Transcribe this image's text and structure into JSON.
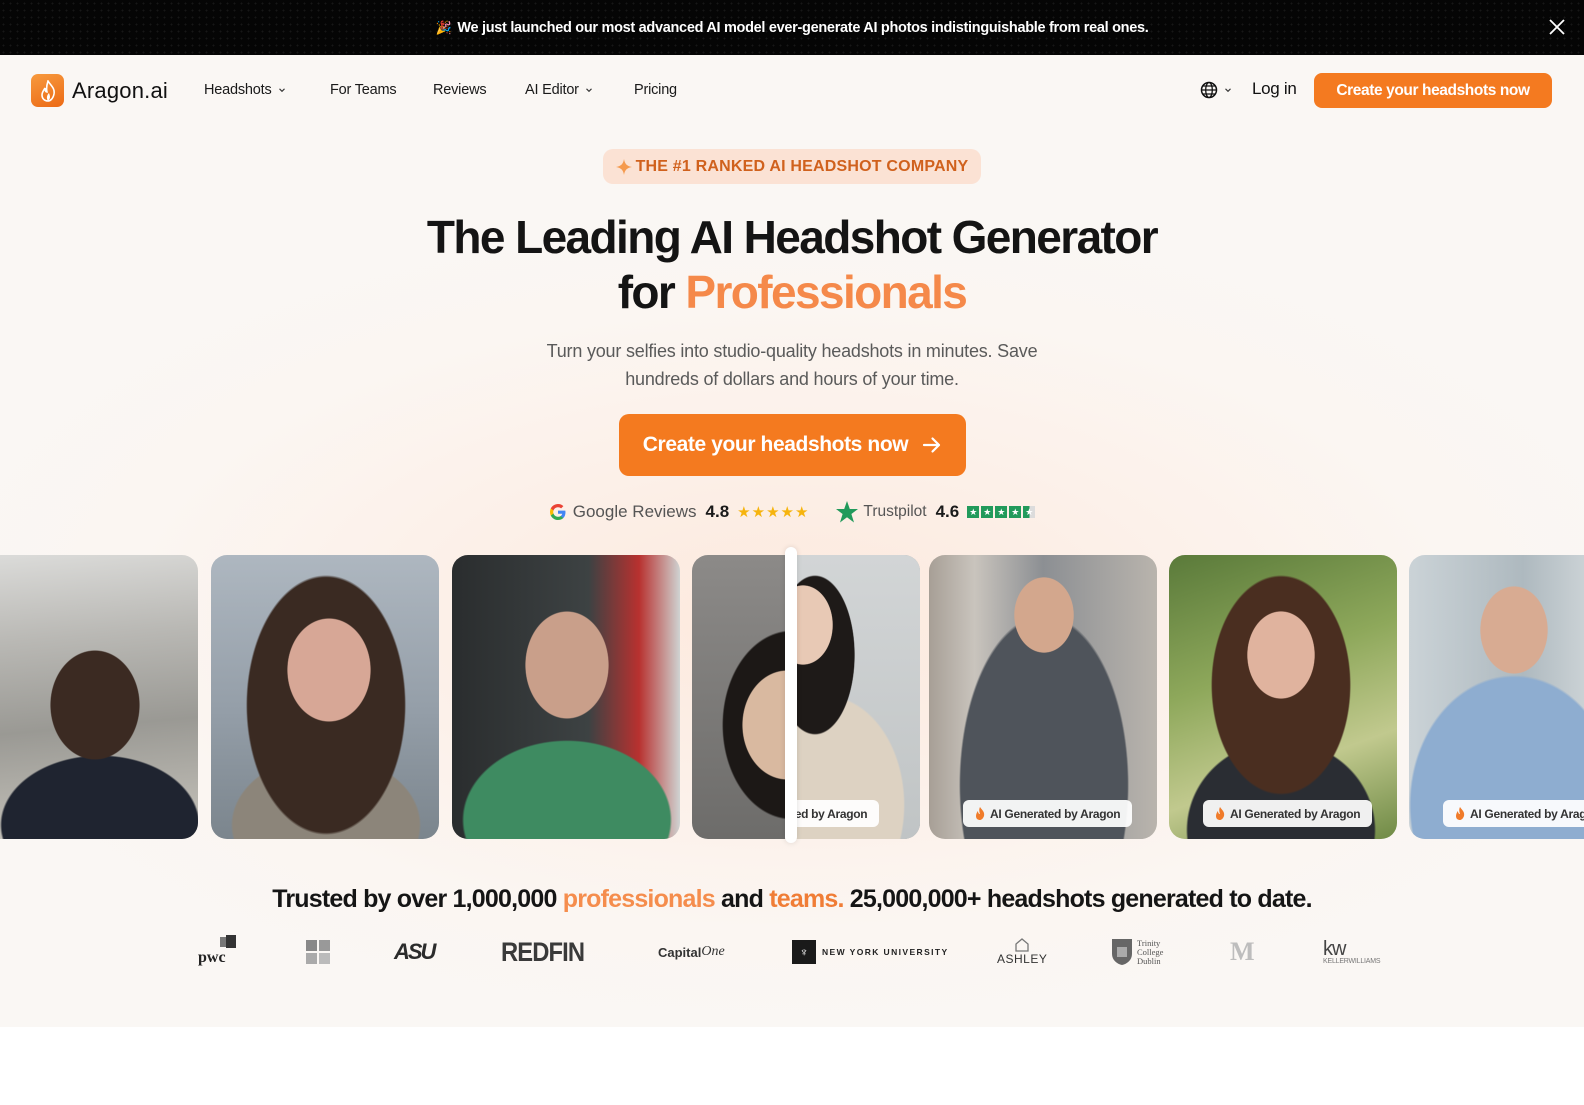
{
  "banner": {
    "icon": "party-popper-icon",
    "text": "We just launched our most advanced AI model ever-generate AI photos indistinguishable from real ones.",
    "close_icon": "close-icon"
  },
  "nav": {
    "logo_text": "Aragon.ai",
    "items": [
      {
        "label": "Headshots",
        "has_dropdown": true
      },
      {
        "label": "For Teams",
        "has_dropdown": false
      },
      {
        "label": "Reviews",
        "has_dropdown": false
      },
      {
        "label": "AI Editor",
        "has_dropdown": true
      },
      {
        "label": "Pricing",
        "has_dropdown": false
      }
    ],
    "language_icon": "globe-icon",
    "login_label": "Log in",
    "cta_label": "Create your headshots now"
  },
  "hero": {
    "badge": "THE #1 RANKED AI HEADSHOT COMPANY",
    "title_line1": "The Leading AI Headshot Generator",
    "title_line2_prefix": "for ",
    "title_line2_accent": "Professionals",
    "subtitle_line1": "Turn your selfies into studio-quality headshots in minutes. Save",
    "subtitle_line2": "hundreds of dollars and hours of your time.",
    "cta_label": "Create your headshots now",
    "cta_icon": "arrow-right-icon"
  },
  "ratings": {
    "google": {
      "label": "Google Reviews",
      "score": "4.8",
      "stars": 5
    },
    "trustpilot": {
      "label": "Trustpilot",
      "score": "4.6",
      "stars": 4.5
    }
  },
  "gallery": {
    "tag_label": "AI Generated by Aragon",
    "tag_label_partial": "ted by Aragon",
    "cards": [
      {
        "type": "selfie",
        "desc": "man in car selfie"
      },
      {
        "type": "selfie",
        "desc": "woman with long hair selfie"
      },
      {
        "type": "selfie",
        "desc": "bald man in green shirt in car"
      },
      {
        "type": "before-after",
        "desc": "woman selfie / AI headshot comparison"
      },
      {
        "type": "ai",
        "desc": "man in grey suit on street"
      },
      {
        "type": "ai",
        "desc": "woman in black blazer outdoors"
      },
      {
        "type": "ai",
        "desc": "man in blue shirt arms crossed"
      }
    ]
  },
  "trusted": {
    "prefix": "Trusted by over 1,000,000 ",
    "accent1": "professionals",
    "mid": " and ",
    "accent2": "teams.",
    "suffix": " 25,000,000+ headshots generated to date."
  },
  "logos": [
    "pwc",
    "Microsoft",
    "ASU",
    "REDFIN",
    "Capital One",
    "NEW YORK UNIVERSITY",
    "ASHLEY",
    "Trinity College Dublin",
    "University of Michigan",
    "KELLERWILLIAMS"
  ],
  "logo_text": {
    "pwc": "pwc",
    "asu": "ASU",
    "redfin": "REDFIN",
    "capital": "Capital",
    "one": "One",
    "nyu": "NEW YORK UNIVERSITY",
    "ashley": "ASHLEY",
    "trinity1": "Trinity",
    "trinity2": "College",
    "trinity3": "Dublin",
    "kw": "kw",
    "kw_sub": "KELLERWILLIAMS"
  },
  "colors": {
    "brand_orange": "#f47a20",
    "accent_text": "#f5894a",
    "trustpilot_green": "#219a5b",
    "google_star": "#f6b40e"
  }
}
